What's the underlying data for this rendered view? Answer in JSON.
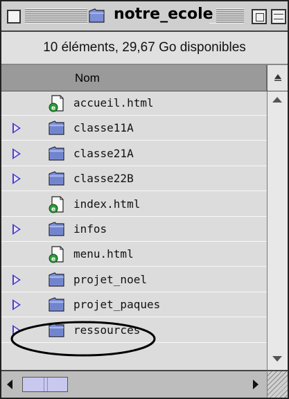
{
  "window": {
    "title": "notre_ecole",
    "status": "10 éléments, 29,67 Go disponibles"
  },
  "header": {
    "name_column": "Nom",
    "sort_icon": "sort-direction-icon"
  },
  "items": [
    {
      "name": "accueil.html",
      "kind": "html-file",
      "expandable": false
    },
    {
      "name": "classe11A",
      "kind": "folder",
      "expandable": true
    },
    {
      "name": "classe21A",
      "kind": "folder",
      "expandable": true
    },
    {
      "name": "classe22B",
      "kind": "folder",
      "expandable": true
    },
    {
      "name": "index.html",
      "kind": "html-file",
      "expandable": false
    },
    {
      "name": "infos",
      "kind": "folder",
      "expandable": true
    },
    {
      "name": "menu.html",
      "kind": "html-file",
      "expandable": false
    },
    {
      "name": "projet_noel",
      "kind": "folder",
      "expandable": true
    },
    {
      "name": "projet_paques",
      "kind": "folder",
      "expandable": true
    },
    {
      "name": "ressources",
      "kind": "folder",
      "expandable": true,
      "highlighted_by_annotation": true
    }
  ],
  "colors": {
    "disclosure": "#4a40c8",
    "folder": "#7c8fd8",
    "annotation": "#000000"
  }
}
